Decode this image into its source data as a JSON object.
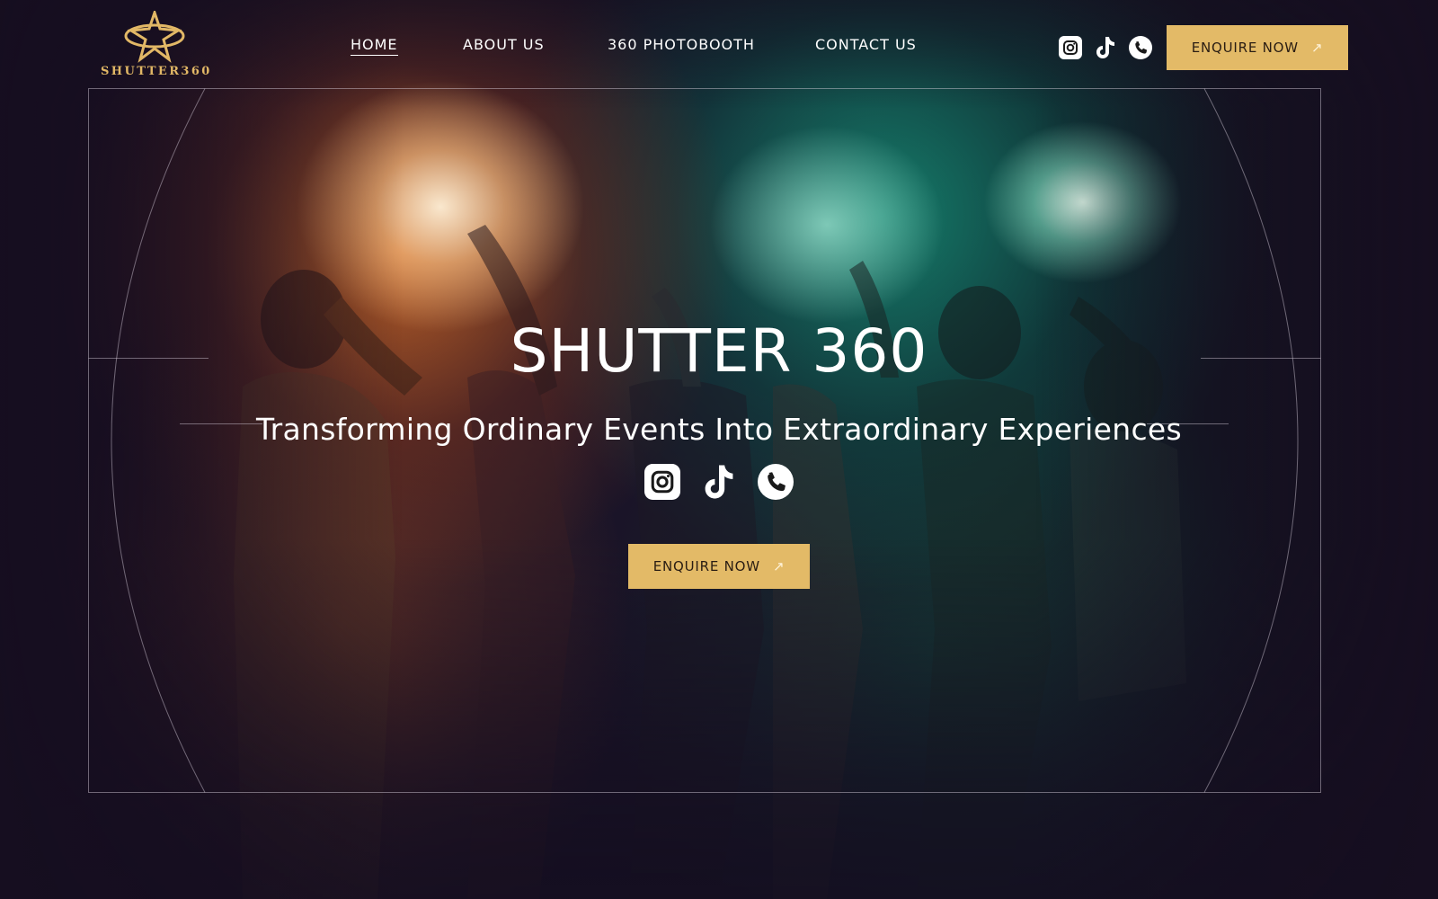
{
  "brand": {
    "logo_text": "SHUTTER360",
    "accent_color": "#e3ba67"
  },
  "nav": {
    "items": [
      {
        "label": "HOME",
        "active": true
      },
      {
        "label": "ABOUT US",
        "active": false
      },
      {
        "label": "360 PHOTOBOOTH",
        "active": false
      },
      {
        "label": "CONTACT US",
        "active": false
      }
    ]
  },
  "header": {
    "social_icons": [
      "instagram-icon",
      "tiktok-icon",
      "phone-icon"
    ],
    "enquire_label": "ENQUIRE NOW",
    "enquire_arrow": "↗"
  },
  "hero": {
    "title": "SHUTTER 360",
    "subtitle": "Transforming Ordinary Events Into Extraordinary Experiences",
    "social_icons": [
      "instagram-icon",
      "tiktok-icon",
      "phone-icon"
    ],
    "enquire_label": "ENQUIRE NOW",
    "enquire_arrow": "↗"
  }
}
